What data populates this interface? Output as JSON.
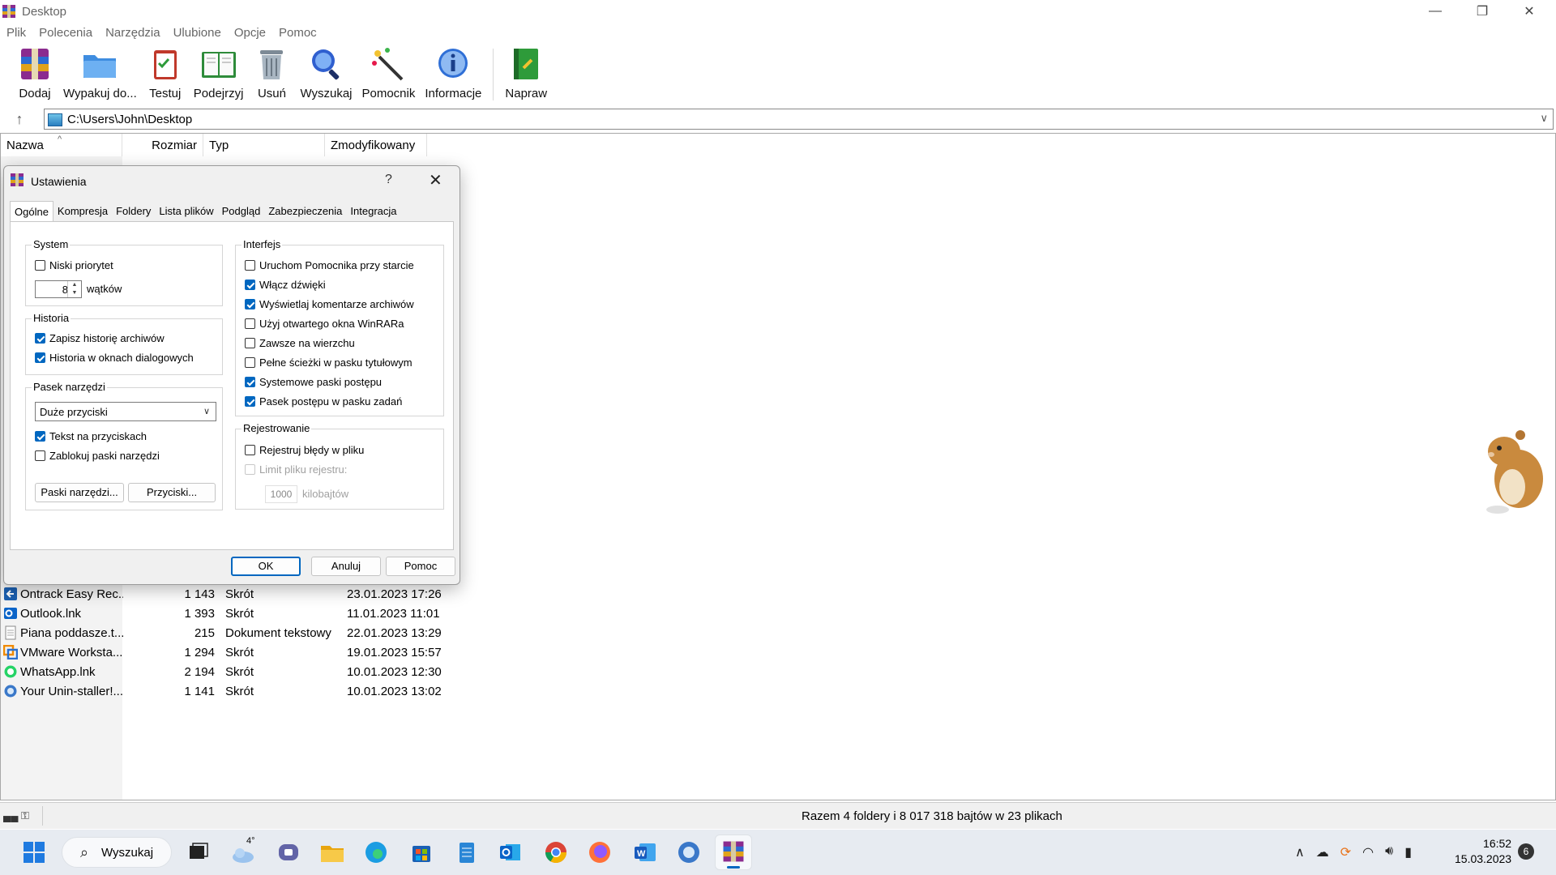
{
  "window": {
    "title": "Desktop"
  },
  "menu": [
    "Plik",
    "Polecenia",
    "Narzędzia",
    "Ulubione",
    "Opcje",
    "Pomoc"
  ],
  "toolbar": [
    {
      "label": "Dodaj",
      "icon": "add-archive-icon"
    },
    {
      "label": "Wypakuj do...",
      "icon": "extract-folder-icon"
    },
    {
      "label": "Testuj",
      "icon": "test-clipboard-icon"
    },
    {
      "label": "Podejrzyj",
      "icon": "view-book-icon"
    },
    {
      "label": "Usuń",
      "icon": "trash-icon"
    },
    {
      "label": "Wyszukaj",
      "icon": "magnifier-icon"
    },
    {
      "label": "Pomocnik",
      "icon": "wizard-wand-icon"
    },
    {
      "label": "Informacje",
      "icon": "info-icon"
    },
    {
      "label": "Napraw",
      "icon": "repair-book-icon"
    }
  ],
  "address": {
    "path": "C:\\Users\\John\\Desktop"
  },
  "columns": {
    "name": "Nazwa",
    "size": "Rozmiar",
    "type": "Typ",
    "modified": "Zmodyfikowany"
  },
  "files": [
    {
      "name": "Ontrack Easy Rec...",
      "size": "1 143",
      "type": "Skrót",
      "modified": "23.01.2023 17:26",
      "icon": "ontrack-shortcut-icon"
    },
    {
      "name": "Outlook.lnk",
      "size": "1 393",
      "type": "Skrót",
      "modified": "11.01.2023 11:01",
      "icon": "outlook-shortcut-icon"
    },
    {
      "name": "Piana poddasze.t...",
      "size": "215",
      "type": "Dokument tekstowy",
      "modified": "22.01.2023 13:29",
      "icon": "text-document-icon"
    },
    {
      "name": "VMware Worksta...",
      "size": "1 294",
      "type": "Skrót",
      "modified": "19.01.2023 15:57",
      "icon": "vmware-shortcut-icon"
    },
    {
      "name": "WhatsApp.lnk",
      "size": "2 194",
      "type": "Skrót",
      "modified": "10.01.2023 12:30",
      "icon": "whatsapp-shortcut-icon"
    },
    {
      "name": "Your Unin-staller!...",
      "size": "1 141",
      "type": "Skrót",
      "modified": "10.01.2023 13:02",
      "icon": "uninstaller-shortcut-icon"
    }
  ],
  "status": {
    "summary": "Razem 4 foldery i 8 017 318 bajtów w 23 plikach"
  },
  "dialog": {
    "title": "Ustawienia",
    "help": "?",
    "tabs": [
      "Ogólne",
      "Kompresja",
      "Foldery",
      "Lista plików",
      "Podgląd",
      "Zabezpieczenia",
      "Integracja"
    ],
    "system": {
      "title": "System",
      "low_priority": {
        "label": "Niski priorytet",
        "checked": false
      },
      "threads_value": "8",
      "threads_label": "wątków"
    },
    "history": {
      "title": "Historia",
      "save_history": {
        "label": "Zapisz historię archiwów",
        "checked": true
      },
      "dialog_history": {
        "label": "Historia w oknach dialogowych",
        "checked": true
      }
    },
    "toolbar_group": {
      "title": "Pasek narzędzi",
      "size_value": "Duże przyciski",
      "text_on_buttons": {
        "label": "Tekst na przyciskach",
        "checked": true
      },
      "lock_toolbars": {
        "label": "Zablokuj paski narzędzi",
        "checked": false
      },
      "toolbars_button": "Paski narzędzi...",
      "buttons_button": "Przyciski..."
    },
    "interface": {
      "title": "Interfejs",
      "items": [
        {
          "label": "Uruchom Pomocnika przy starcie",
          "checked": false
        },
        {
          "label": "Włącz dźwięki",
          "checked": true
        },
        {
          "label": "Wyświetlaj komentarze archiwów",
          "checked": true
        },
        {
          "label": "Użyj otwartego okna WinRARa",
          "checked": false
        },
        {
          "label": "Zawsze na wierzchu",
          "checked": false
        },
        {
          "label": "Pełne ścieżki w pasku tytułowym",
          "checked": false
        },
        {
          "label": "Systemowe paski postępu",
          "checked": true
        },
        {
          "label": "Pasek postępu w pasku zadań",
          "checked": true
        }
      ]
    },
    "logging": {
      "title": "Rejestrowanie",
      "log_errors": {
        "label": "Rejestruj błędy w pliku",
        "checked": false
      },
      "limit_size": {
        "label": "Limit pliku rejestru:",
        "checked": false,
        "disabled": true
      },
      "limit_value": "1000",
      "limit_unit": "kilobajtów"
    },
    "buttons": {
      "ok": "OK",
      "cancel": "Anuluj",
      "help": "Pomoc"
    }
  },
  "taskbar": {
    "search_label": "Wyszukaj",
    "weather_temp": "4°",
    "time": "16:52",
    "date": "15.03.2023",
    "notifications": "6"
  }
}
